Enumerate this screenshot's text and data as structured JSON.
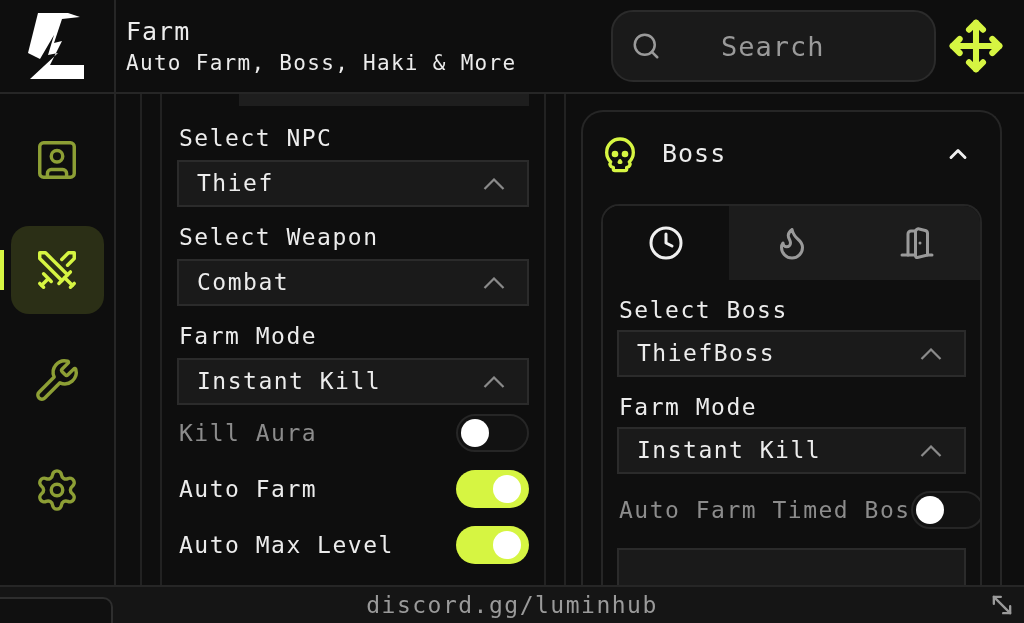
{
  "header": {
    "title": "Farm",
    "subtitle": "Auto Farm, Boss, Haki & More"
  },
  "search": {
    "placeholder": "Search"
  },
  "sidebar": {
    "items": [
      {
        "kind": "profile",
        "selected": false
      },
      {
        "kind": "swords",
        "selected": true
      },
      {
        "kind": "wrench",
        "selected": false
      },
      {
        "kind": "gear",
        "selected": false
      }
    ]
  },
  "farm_panel": {
    "controls": [
      {
        "kind": "dropdown",
        "label": "Select NPC",
        "value": "Thief"
      },
      {
        "kind": "dropdown",
        "label": "Select Weapon",
        "value": "Combat"
      },
      {
        "kind": "dropdown",
        "label": "Farm Mode",
        "value": "Instant Kill"
      },
      {
        "kind": "toggle",
        "label": "Kill Aura",
        "on": false,
        "disabled": true
      },
      {
        "kind": "toggle",
        "label": "Auto Farm",
        "on": true,
        "disabled": false
      },
      {
        "kind": "toggle",
        "label": "Auto Max Level",
        "on": true,
        "disabled": false
      }
    ]
  },
  "boss_panel": {
    "title": "Boss",
    "expanded": true,
    "tabs": [
      {
        "kind": "clock",
        "selected": true
      },
      {
        "kind": "flame",
        "selected": false
      },
      {
        "kind": "door",
        "selected": false
      }
    ],
    "controls": [
      {
        "kind": "dropdown",
        "label": "Select Boss",
        "value": "ThiefBoss"
      },
      {
        "kind": "dropdown",
        "label": "Farm Mode",
        "value": "Instant Kill"
      },
      {
        "kind": "toggle",
        "label": "Auto Farm Timed Bos",
        "on": false,
        "disabled": true
      },
      {
        "kind": "button"
      }
    ]
  },
  "footer": {
    "link": "discord.gg/luminhub"
  }
}
